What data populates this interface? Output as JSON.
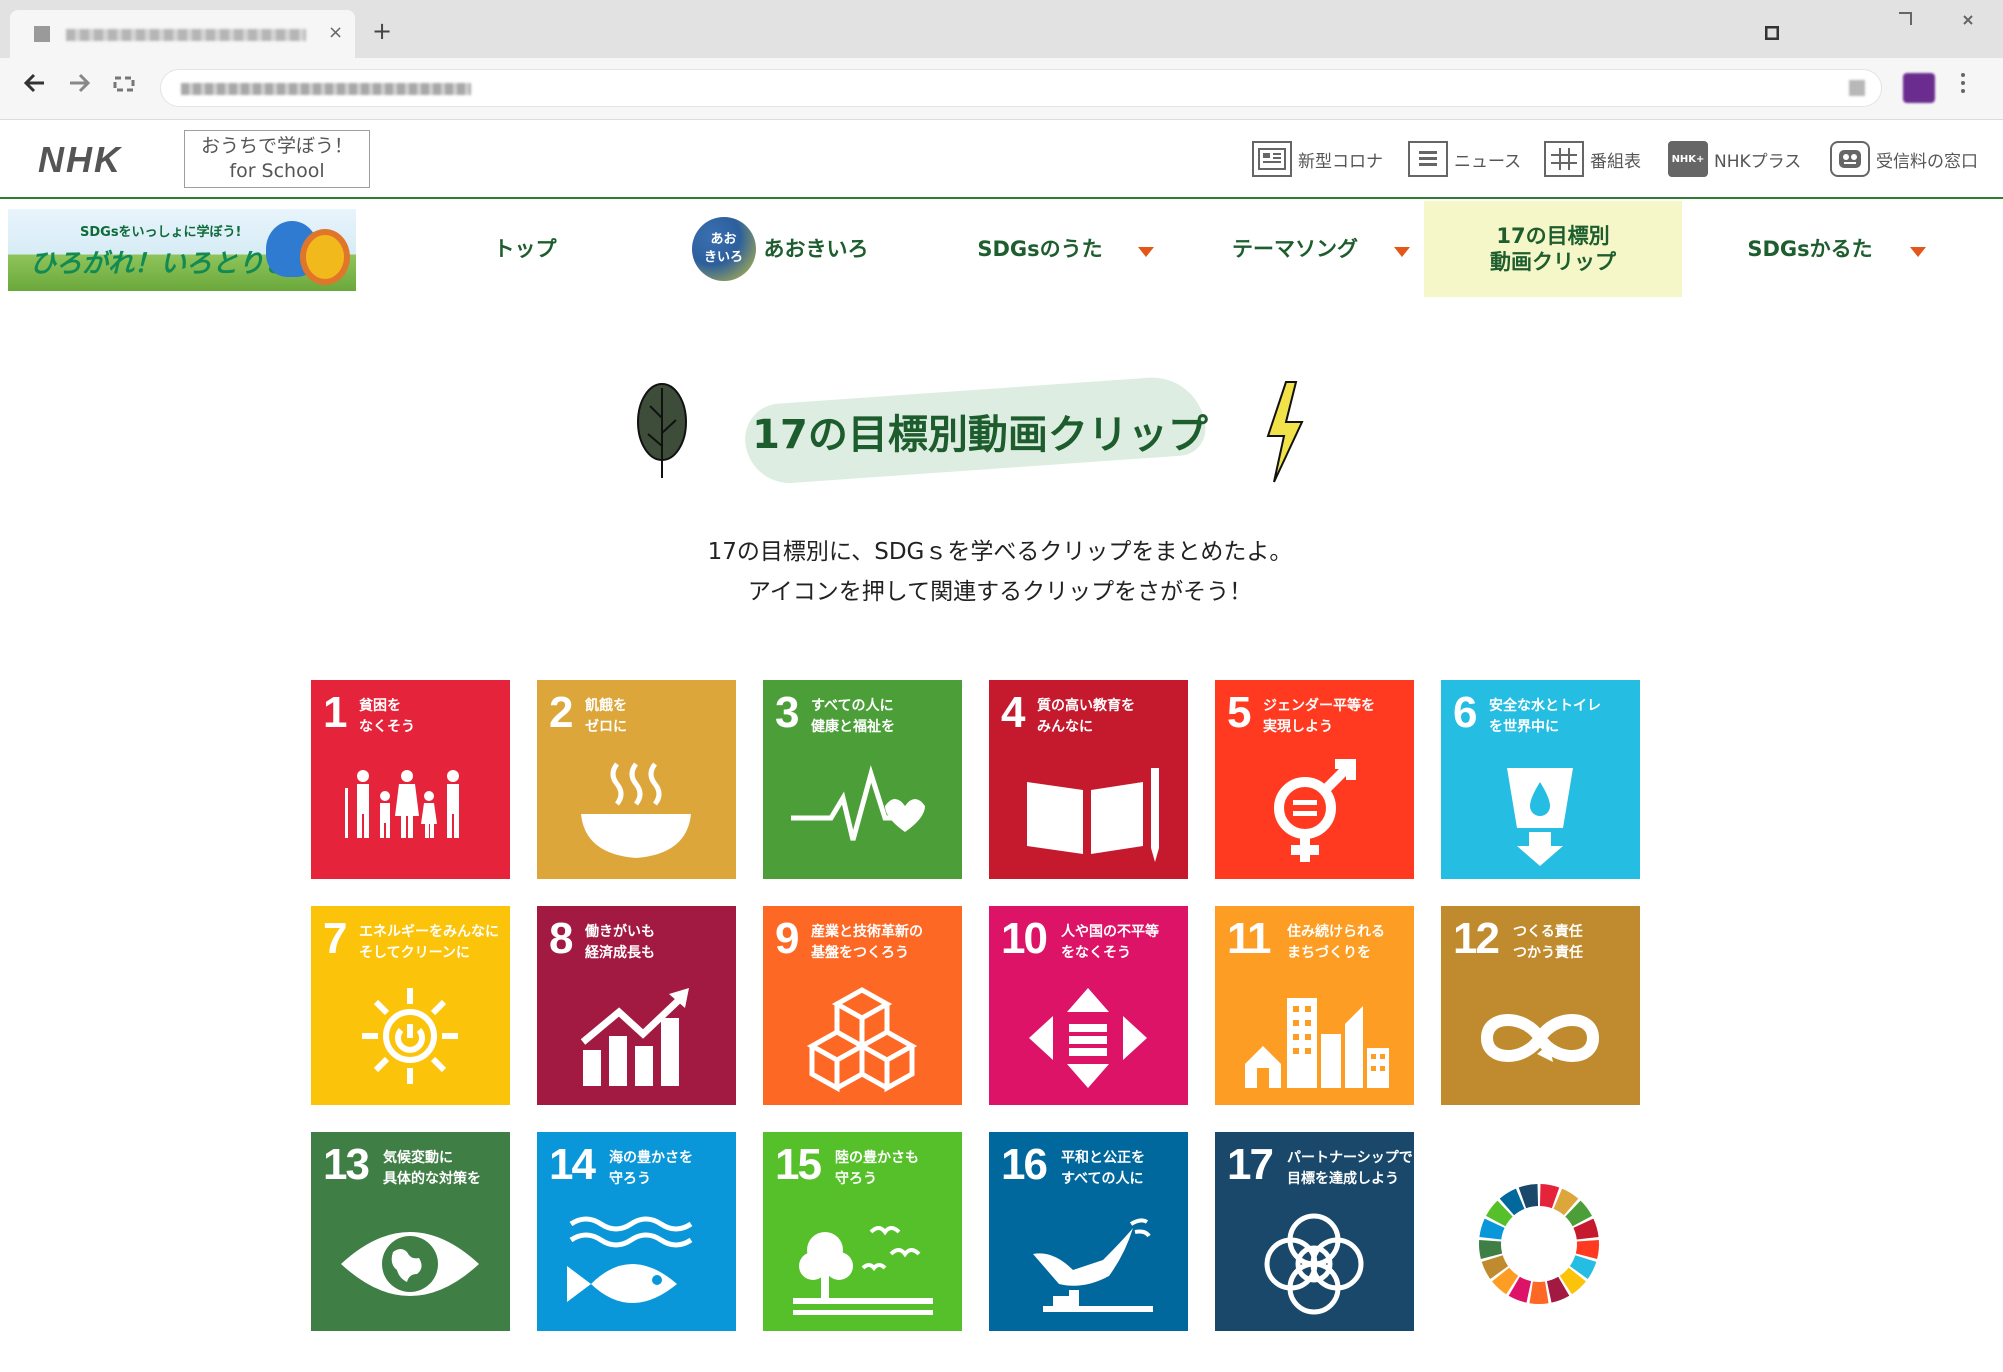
{
  "browser": {
    "new_tab_glyph": "+",
    "tab_close_glyph": "×"
  },
  "header": {
    "logo": "NHK",
    "school_line1": "おうちで学ぼう！",
    "school_line2": "for School",
    "utilities": [
      {
        "icon": "corona-icon",
        "label": "新型コロナ"
      },
      {
        "icon": "news-icon",
        "label": "ニュース"
      },
      {
        "icon": "program-guide-icon",
        "label": "番組表"
      },
      {
        "icon": "nhk-plus-icon",
        "label": "NHKプラス",
        "badge": "NHK+"
      },
      {
        "icon": "fee-window-icon",
        "label": "受信料の窓口"
      }
    ]
  },
  "banner": {
    "small": "SDGsをいっしょに学ぼう!",
    "main": "ひろがれ！いろとりどり"
  },
  "nav": {
    "items": [
      {
        "label": "トップ"
      },
      {
        "label": "あおきいろ",
        "badge_line1": "あお",
        "badge_line2": "きいろ"
      },
      {
        "label": "SDGsのうた"
      },
      {
        "label": "テーマソング"
      },
      {
        "label_line1": "17の目標別",
        "label_line2": "動画クリップ"
      },
      {
        "label": "SDGsかるた"
      }
    ]
  },
  "page": {
    "title": "17の目標別動画クリップ",
    "intro_line1": "17の目標別に、SDGｓを学べるクリップをまとめたよ。",
    "intro_line2": "アイコンを押して関連するクリップをさがそう！"
  },
  "goals": [
    {
      "num": "1",
      "text": "貧困を\nなくそう",
      "color": "#e5243b",
      "icon": "family-icon"
    },
    {
      "num": "2",
      "text": "飢餓を\nゼロに",
      "color": "#dda63a",
      "icon": "bowl-icon"
    },
    {
      "num": "3",
      "text": "すべての人に\n健康と福祉を",
      "color": "#4c9f38",
      "icon": "heartbeat-icon"
    },
    {
      "num": "4",
      "text": "質の高い教育を\nみんなに",
      "color": "#c5192d",
      "icon": "book-icon"
    },
    {
      "num": "5",
      "text": "ジェンダー平等を\n実現しよう",
      "color": "#ff3a21",
      "icon": "gender-icon"
    },
    {
      "num": "6",
      "text": "安全な水とトイレ\nを世界中に",
      "color": "#26bde2",
      "icon": "water-icon"
    },
    {
      "num": "7",
      "text": "エネルギーをみんなに\nそしてクリーンに",
      "color": "#fcc30b",
      "icon": "sun-power-icon"
    },
    {
      "num": "8",
      "text": "働きがいも\n経済成長も",
      "color": "#a21942",
      "icon": "growth-chart-icon"
    },
    {
      "num": "9",
      "text": "産業と技術革新の\n基盤をつくろう",
      "color": "#fd6925",
      "icon": "cubes-icon"
    },
    {
      "num": "10",
      "text": "人や国の不平等\nをなくそう",
      "color": "#dd1367",
      "icon": "equality-arrows-icon"
    },
    {
      "num": "11",
      "text": "住み続けられる\nまちづくりを",
      "color": "#fd9d24",
      "icon": "city-icon"
    },
    {
      "num": "12",
      "text": "つくる責任\nつかう責任",
      "color": "#bf8b2e",
      "icon": "infinity-icon"
    },
    {
      "num": "13",
      "text": "気候変動に\n具体的な対策を",
      "color": "#3f7e44",
      "icon": "eye-globe-icon"
    },
    {
      "num": "14",
      "text": "海の豊かさを\n守ろう",
      "color": "#0a97d9",
      "icon": "fish-icon"
    },
    {
      "num": "15",
      "text": "陸の豊かさも\n守ろう",
      "color": "#56c02b",
      "icon": "tree-birds-icon"
    },
    {
      "num": "16",
      "text": "平和と公正を\nすべての人に",
      "color": "#00689d",
      "icon": "dove-icon"
    },
    {
      "num": "17",
      "text": "パートナーシップで\n目標を達成しよう",
      "color": "#19486a",
      "icon": "rings-icon"
    }
  ],
  "wheel_colors": [
    "#e5243b",
    "#dda63a",
    "#4c9f38",
    "#c5192d",
    "#ff3a21",
    "#26bde2",
    "#fcc30b",
    "#a21942",
    "#fd6925",
    "#dd1367",
    "#fd9d24",
    "#bf8b2e",
    "#3f7e44",
    "#0a97d9",
    "#56c02b",
    "#00689d",
    "#19486a"
  ]
}
